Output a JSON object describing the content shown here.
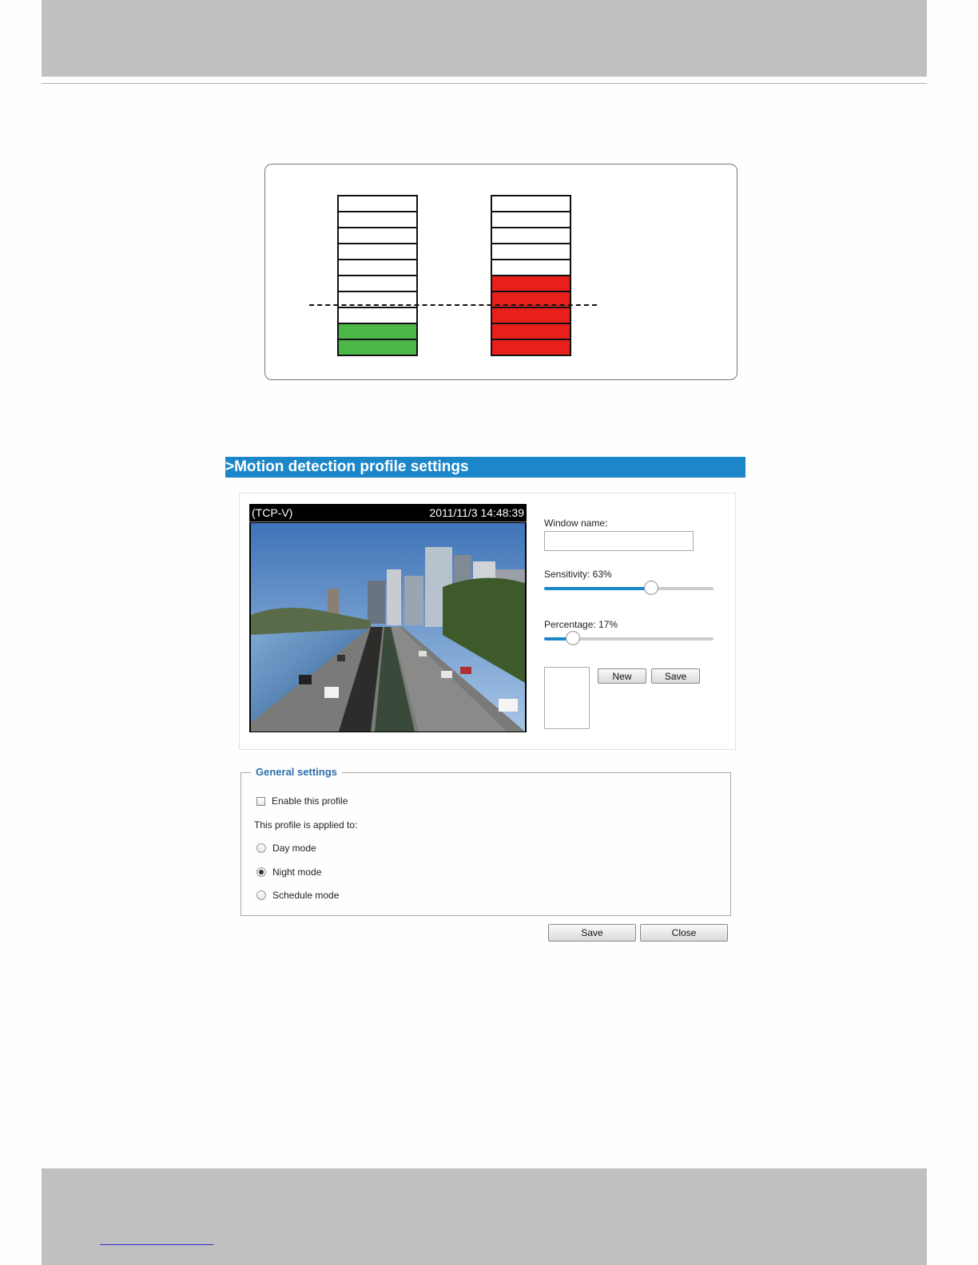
{
  "diagram": {
    "left_meter": [
      "#ffffff",
      "#ffffff",
      "#ffffff",
      "#ffffff",
      "#ffffff",
      "#ffffff",
      "#ffffff",
      "#ffffff",
      "#4cb848",
      "#4cb848"
    ],
    "right_meter": [
      "#ffffff",
      "#ffffff",
      "#ffffff",
      "#ffffff",
      "#ffffff",
      "#e8201c",
      "#e8201c",
      "#e8201c",
      "#e8201c",
      "#e8201c"
    ]
  },
  "header": {
    "prefix": ">",
    "title": "Motion detection profile settings"
  },
  "video": {
    "source": "(TCP-V)",
    "timestamp": "2011/11/3 14:48:39"
  },
  "window": {
    "name_label": "Window name:",
    "name_value": "",
    "sensitivity_label": "Sensitivity: 63%",
    "sensitivity_value": 63,
    "percentage_label": "Percentage: 17%",
    "percentage_value": 17,
    "new_label": "New",
    "save_label": "Save"
  },
  "general": {
    "legend": "General settings",
    "enable_label": "Enable this profile",
    "enable_checked": false,
    "applied_label": "This profile is applied to:",
    "modes": [
      {
        "label": "Day mode",
        "selected": false
      },
      {
        "label": "Night mode",
        "selected": true
      },
      {
        "label": "Schedule mode",
        "selected": false
      }
    ]
  },
  "footer": {
    "save_label": "Save",
    "close_label": "Close"
  },
  "colors": {
    "accent": "#1b86c8",
    "legend": "#2e6fad"
  }
}
